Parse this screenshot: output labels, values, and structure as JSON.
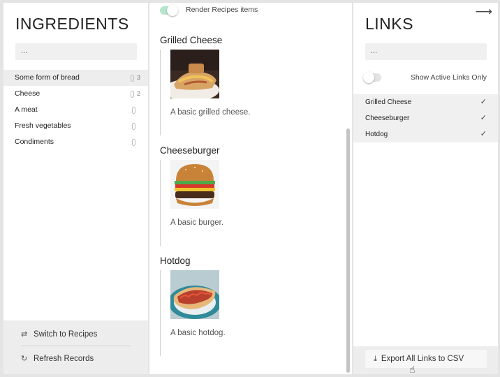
{
  "ingredients_panel": {
    "title": "INGREDIENTS",
    "search_placeholder": "...",
    "items": [
      {
        "label": "Some form of bread",
        "count": "3"
      },
      {
        "label": "Cheese",
        "count": "2"
      },
      {
        "label": "A meat",
        "count": ""
      },
      {
        "label": "Fresh vegetables",
        "count": ""
      },
      {
        "label": "Condiments",
        "count": ""
      }
    ],
    "switch_label": "Switch to Recipes",
    "refresh_label": "Refresh Records"
  },
  "recipes_panel": {
    "render_toggle_label": "Render Recipes items",
    "render_toggle_on": true,
    "recipes": [
      {
        "name": "Grilled Cheese",
        "description": "A basic grilled cheese.",
        "image": "grilled-cheese-photo"
      },
      {
        "name": "Cheeseburger",
        "description": "A basic burger.",
        "image": "cheeseburger-photo"
      },
      {
        "name": "Hotdog",
        "description": "A basic hotdog.",
        "image": "hotdog-photo"
      }
    ]
  },
  "links_panel": {
    "title": "LINKS",
    "search_placeholder": "...",
    "active_only_label": "Show Active Links Only",
    "active_only_on": false,
    "links": [
      {
        "label": "Grilled Cheese",
        "checked": true
      },
      {
        "label": "Cheeseburger",
        "checked": true
      },
      {
        "label": "Hotdog",
        "checked": true
      }
    ],
    "export_label": "Export All Links to CSV"
  },
  "colors": {
    "toggle_on": "#b6e5cd",
    "panel_bg": "#ffffff",
    "app_bg": "#e4e4e4"
  }
}
